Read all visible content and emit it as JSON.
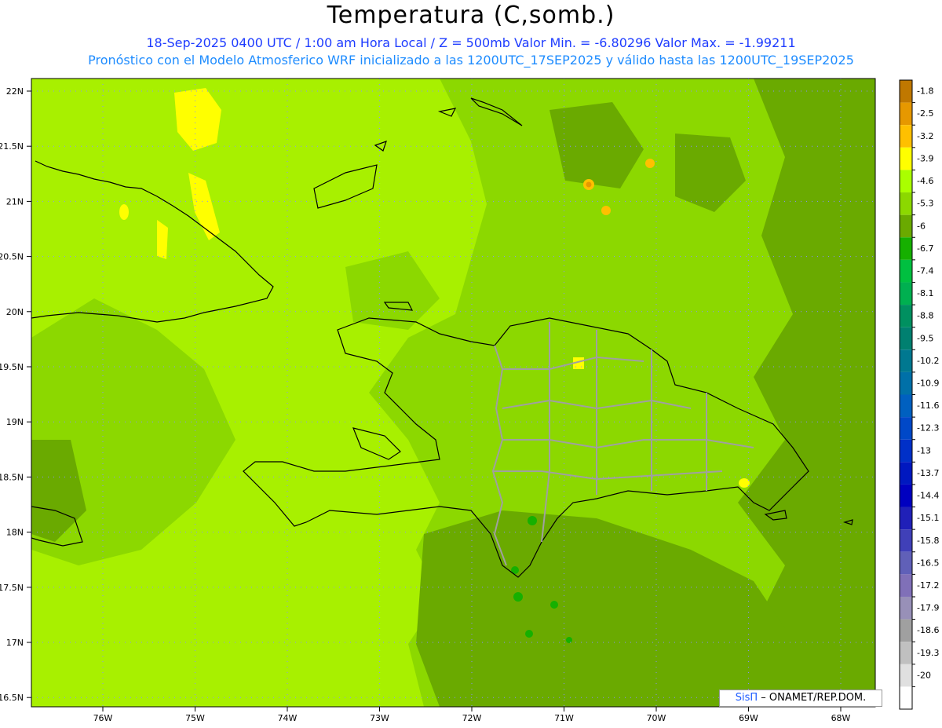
{
  "title": "Temperatura (C,somb.)",
  "subtitle_line1": "18-Sep-2025  0400 UTC / 1:00 am Hora Local / Z = 500mb  Valor Min. = -6.80296  Valor Max. = -1.99211",
  "subtitle_line2": "Pronóstico con el Modelo Atmosferico WRF inicializado a las 1200UTC_17SEP2025 y válido hasta las  1200UTC_19SEP2025",
  "lat_labels": [
    "22N",
    "21.5N",
    "21N",
    "20.5N",
    "20N",
    "19.5N",
    "19N",
    "18.5N",
    "18N",
    "17.5N",
    "17N",
    "16.5N"
  ],
  "lon_labels": [
    "76W",
    "75W",
    "74W",
    "73W",
    "72W",
    "71W",
    "70W",
    "69W",
    "68W"
  ],
  "colorbar": {
    "labels": [
      "-1.8",
      "-2.5",
      "-3.2",
      "-3.9",
      "-4.6",
      "-5.3",
      "-6",
      "-6.7",
      "-7.4",
      "-8.1",
      "-8.8",
      "-9.5",
      "-10.2",
      "-10.9",
      "-11.6",
      "-12.3",
      "-13",
      "-13.7",
      "-14.4",
      "-15.1",
      "-15.8",
      "-16.5",
      "-17.2",
      "-17.9",
      "-18.6",
      "-19.3",
      "-20"
    ],
    "colors": [
      "#c07800",
      "#e69800",
      "#ffc000",
      "#ffff00",
      "#aaff00",
      "#8cd800",
      "#6aaa00",
      "#16b000",
      "#00c040",
      "#00b050",
      "#009060",
      "#008070",
      "#007890",
      "#0070a8",
      "#0060c0",
      "#0048c8",
      "#0030c8",
      "#0018c0",
      "#0000c0",
      "#2020b8",
      "#4040b8",
      "#6060b8",
      "#8070b8",
      "#9890b8",
      "#a0a0a0",
      "#c0c0c0",
      "#e0e0e0",
      "#ffffff"
    ]
  },
  "credit": {
    "brand": "SisΠ",
    "text": "– ONAMET/REP.DOM."
  },
  "colors": {
    "base": "#a8f000",
    "mid": "#8cd800",
    "dark": "#6aaa00",
    "yellow": "#ffff00",
    "orange": "#e69800",
    "green": "#16b000"
  }
}
